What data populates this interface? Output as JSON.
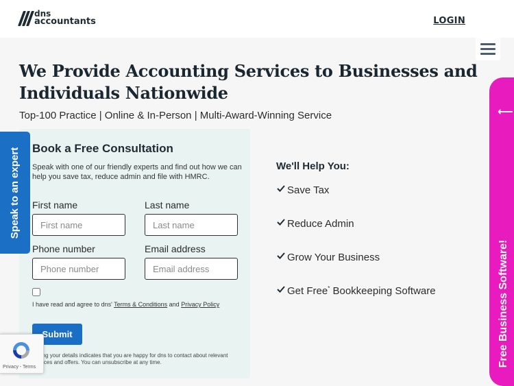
{
  "header": {
    "logo_line1": "dns",
    "logo_line2": "accountants",
    "login_label": "LOGIN"
  },
  "hero": {
    "headline": "We Provide Accounting Services to Businesses and Individuals Nationwide",
    "subheadline": "Top-100 Practice | Online & In-Person | Multi-Award-Winning Service"
  },
  "form": {
    "title": "Book a Free Consultation",
    "intro": "Speak with one of our friendly experts and find out how we can help you save tax, reduce admin and file with HMRC.",
    "first_name_label": "First name",
    "first_name_placeholder": "First name",
    "last_name_label": "Last name",
    "last_name_placeholder": "Last name",
    "phone_label": "Phone number",
    "phone_placeholder": "Phone number",
    "email_label": "Email address",
    "email_placeholder": "Email address",
    "agree_prefix": "I have read and agree to dns' ",
    "terms_link": "Terms & Conditions",
    "agree_and": " and ",
    "privacy_link": "Privacy Policy",
    "submit_label": "Submit",
    "disclaimer": "mitting your details indicates that you are happy for dns to contact about relevant services and offers. You can unsubscribe at any time."
  },
  "help": {
    "title": "We'll Help You:",
    "items": [
      {
        "text": "Save Tax"
      },
      {
        "text": "Reduce Admin"
      },
      {
        "text": "Grow Your Business"
      },
      {
        "text": "Get Free",
        "sup": "*",
        "suffix": " Bookkeeping Software"
      }
    ]
  },
  "side_tabs": {
    "speak_label": "Speak to an expert",
    "software_label": "Free Business Software!",
    "software_arrow": "⟵"
  },
  "recaptcha": {
    "links": "Privacy - Terms"
  },
  "colors": {
    "brand_blue": "#1b6fc5",
    "pink_tab": "#e71bbe",
    "form_bg": "#e9f4f2",
    "heading": "#1a2630"
  },
  "icons": {
    "tick": "check-icon",
    "menu": "hamburger-menu-icon",
    "arrow": "arrow-left-icon"
  }
}
